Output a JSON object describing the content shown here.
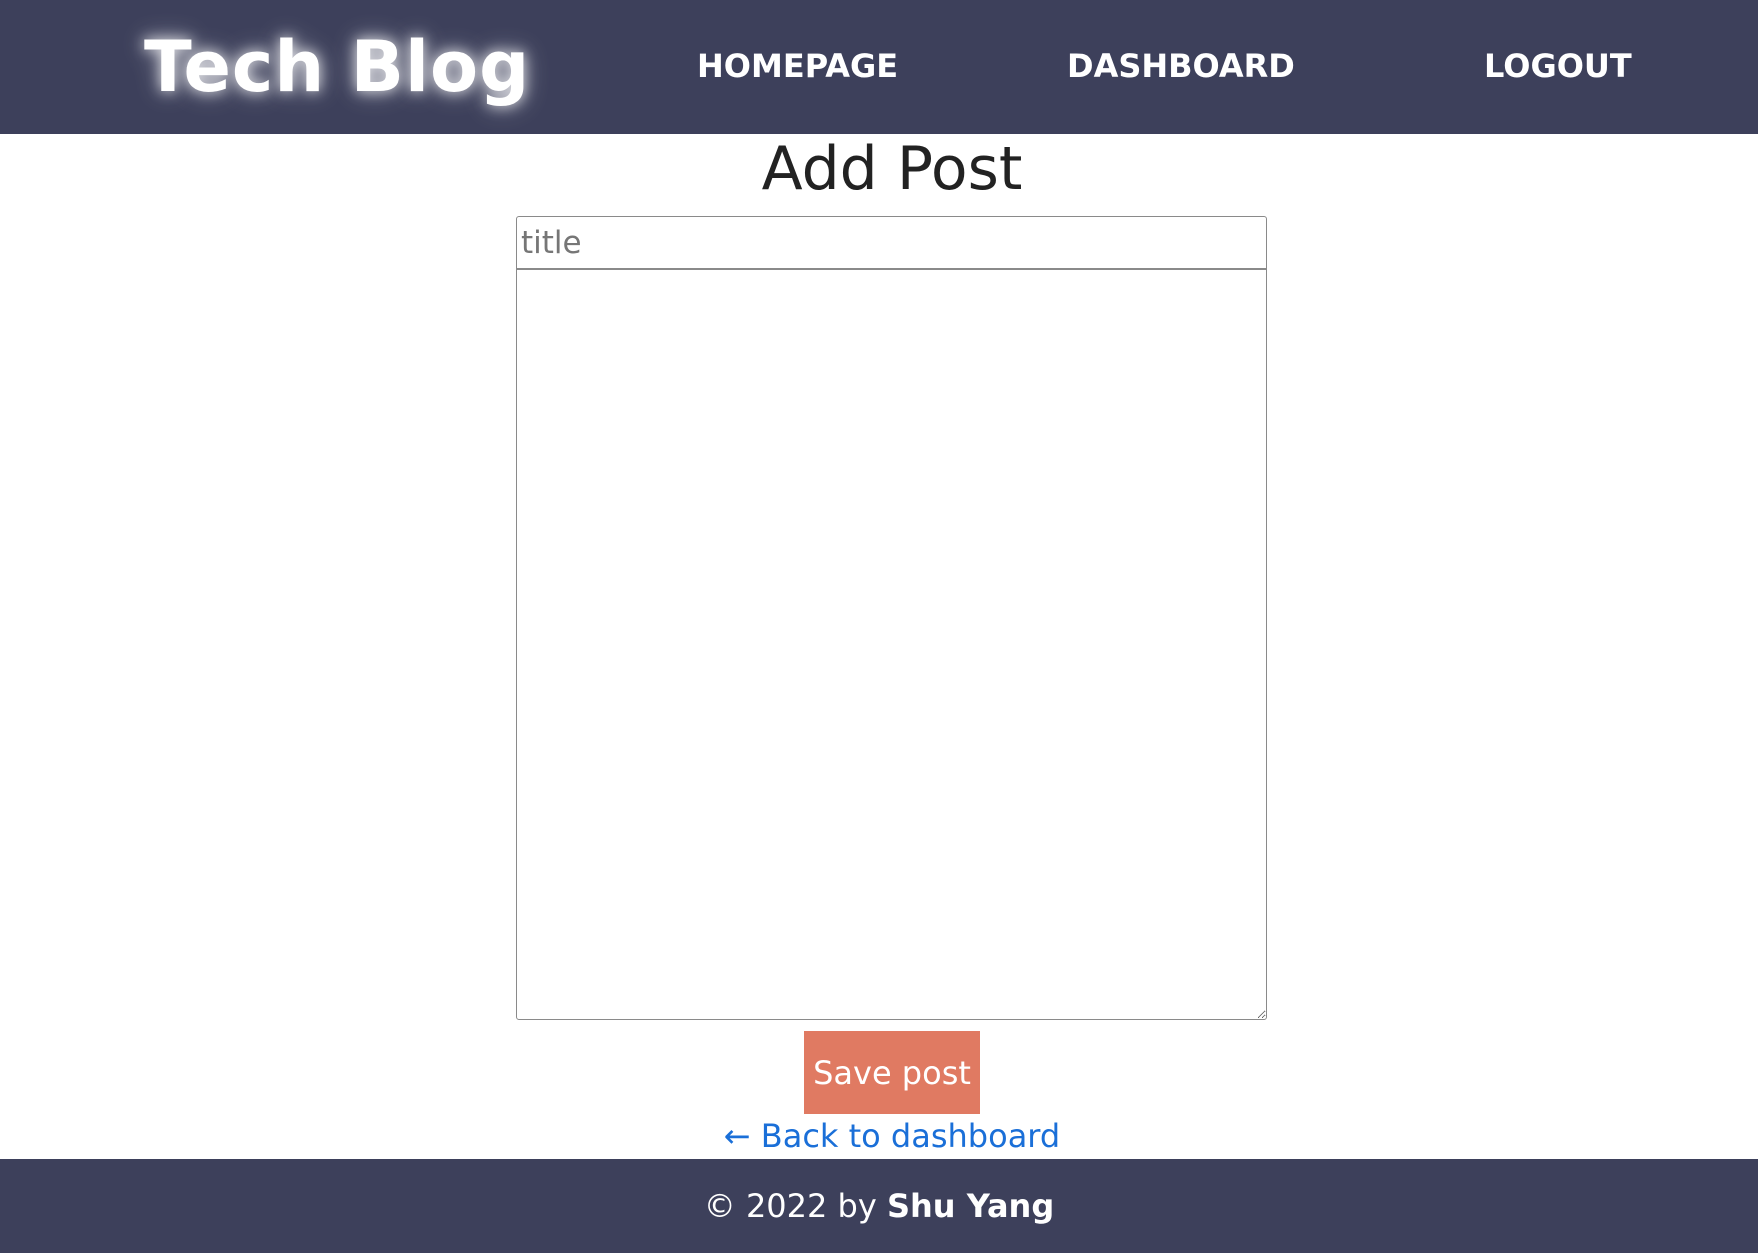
{
  "navbar": {
    "brand": "Tech Blog",
    "links": [
      {
        "label": "HOMEPAGE"
      },
      {
        "label": "DASHBOARD"
      },
      {
        "label": "LOGOUT"
      }
    ],
    "background_color": "#3d405b"
  },
  "main": {
    "title": "Add Post",
    "title_input": {
      "placeholder": "title",
      "value": ""
    },
    "body_textarea": {
      "value": ""
    },
    "save_button_label": "Save post",
    "save_button_color": "#e07a62",
    "back_link_label": "← Back to dashboard",
    "back_link_color": "#1a6fd8"
  },
  "footer": {
    "prefix": "© 2022 by ",
    "author": "Shu Yang"
  }
}
